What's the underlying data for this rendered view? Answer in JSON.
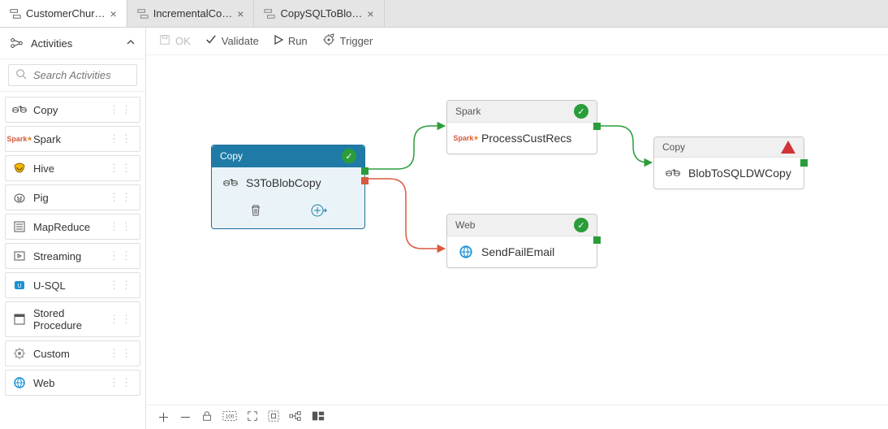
{
  "tabs": [
    {
      "label": "CustomerChur…",
      "active": true
    },
    {
      "label": "IncrementalCo…",
      "active": false
    },
    {
      "label": "CopySQLToBlo…",
      "active": false
    }
  ],
  "sidebar": {
    "title": "Activities",
    "search_placeholder": "Search Activities",
    "items": [
      {
        "label": "Copy"
      },
      {
        "label": "Spark"
      },
      {
        "label": "Hive"
      },
      {
        "label": "Pig"
      },
      {
        "label": "MapReduce"
      },
      {
        "label": "Streaming"
      },
      {
        "label": "U-SQL"
      },
      {
        "label": "Stored Procedure"
      },
      {
        "label": "Custom"
      },
      {
        "label": "Web"
      }
    ]
  },
  "toolbar": {
    "ok": "OK",
    "validate": "Validate",
    "run": "Run",
    "trigger": "Trigger"
  },
  "nodes": {
    "copy1": {
      "type": "Copy",
      "title": "S3ToBlobCopy",
      "status": "ok",
      "selected": true
    },
    "spark": {
      "type": "Spark",
      "title": "ProcessCustRecs",
      "status": "ok"
    },
    "web": {
      "type": "Web",
      "title": "SendFailEmail",
      "status": "ok"
    },
    "copy2": {
      "type": "Copy",
      "title": "BlobToSQLDWCopy",
      "status": "warn"
    }
  }
}
